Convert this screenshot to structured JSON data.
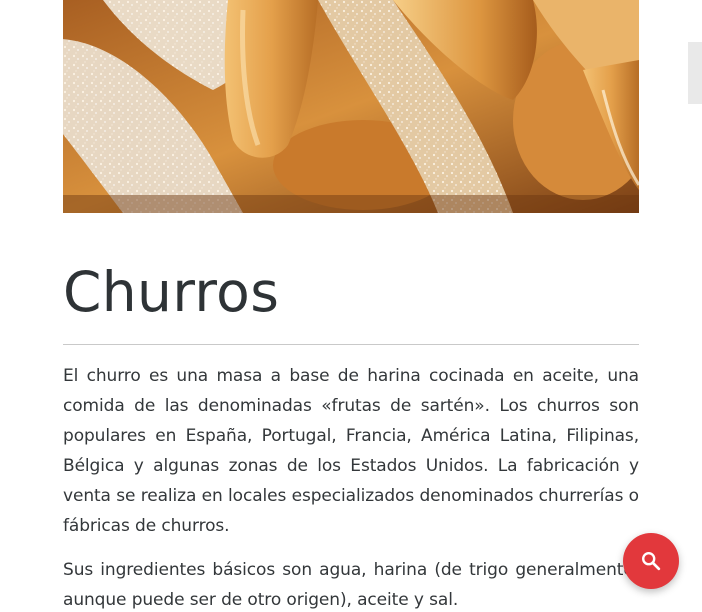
{
  "article": {
    "hero_image_alt": "churros-photo",
    "title": "Churros",
    "paragraphs": [
      "El churro es una masa a base de harina cocinada en aceite, una comida de las denominadas «frutas de sartén». Los churros son populares en España, Portugal, Francia, América Latina, Filipinas, Bélgica y algunas zonas de los Estados Unidos. La fabricación y venta se realiza en locales especializados denominados churrerías o fábricas de churros.",
      "Sus ingredientes básicos son agua, harina (de trigo generalmente, aunque puede ser de otro origen), aceite y sal."
    ]
  },
  "search_button": {
    "icon": "search-icon",
    "color": "#e2383c"
  },
  "colors": {
    "text": "#33373a",
    "divider": "#c9c9c9",
    "accent": "#e2383c"
  }
}
